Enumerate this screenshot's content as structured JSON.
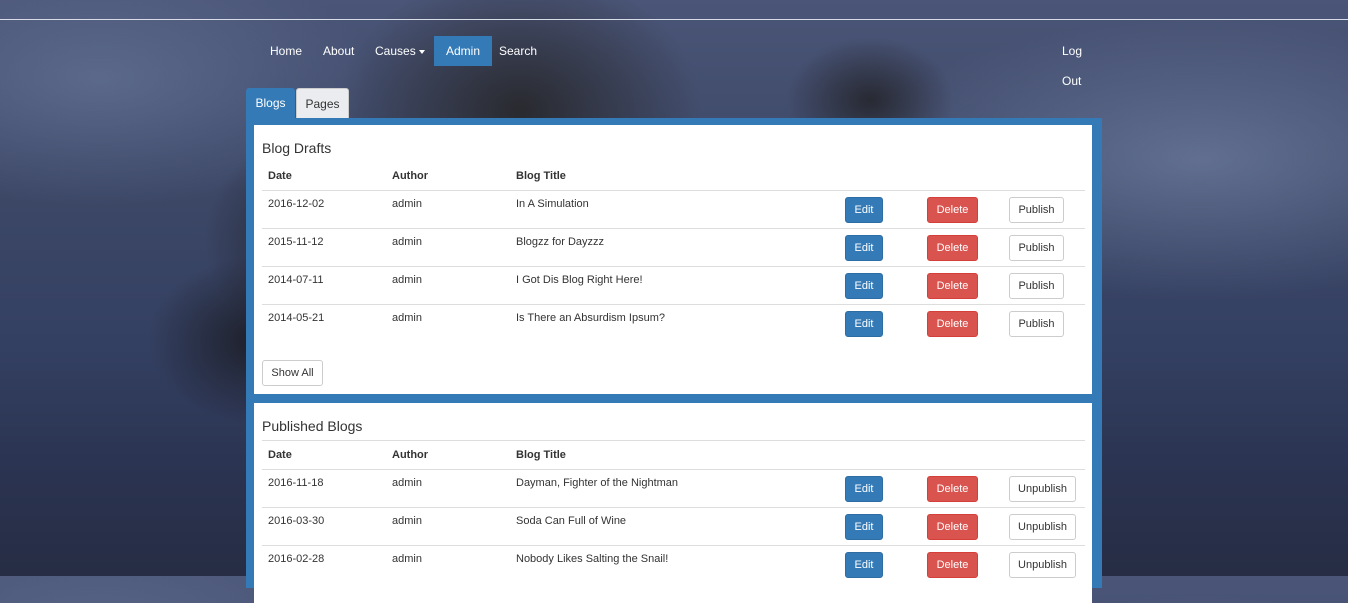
{
  "nav": {
    "items": [
      {
        "label": "Home"
      },
      {
        "label": "About"
      },
      {
        "label": "Causes"
      },
      {
        "label": "Admin"
      },
      {
        "label": "Search"
      }
    ],
    "logout": "Log Out"
  },
  "tabs": [
    {
      "label": "Blogs"
    },
    {
      "label": "Pages"
    }
  ],
  "drafts": {
    "title": "Blog Drafts",
    "columns": [
      "Date",
      "Author",
      "Blog Title"
    ],
    "rows": [
      {
        "date": "2016-12-02",
        "author": "admin",
        "title": "In A Simulation"
      },
      {
        "date": "2015-11-12",
        "author": "admin",
        "title": "Blogzz for Dayzzz"
      },
      {
        "date": "2014-07-11",
        "author": "admin",
        "title": "I Got Dis Blog Right Here!"
      },
      {
        "date": "2014-05-21",
        "author": "admin",
        "title": "Is There an Absurdism Ipsum?"
      }
    ],
    "edit_label": "Edit",
    "delete_label": "Delete",
    "publish_label": "Publish",
    "show_all_label": "Show All"
  },
  "published": {
    "title": "Published Blogs",
    "columns": [
      "Date",
      "Author",
      "Blog Title"
    ],
    "rows": [
      {
        "date": "2016-11-18",
        "author": "admin",
        "title": "Dayman, Fighter of the Nightman"
      },
      {
        "date": "2016-03-30",
        "author": "admin",
        "title": "Soda Can Full of Wine"
      },
      {
        "date": "2016-02-28",
        "author": "admin",
        "title": "Nobody Likes Salting the Snail!"
      }
    ],
    "edit_label": "Edit",
    "delete_label": "Delete",
    "unpublish_label": "Unpublish"
  },
  "colors": {
    "primary": "#337ab7",
    "danger": "#d9534f"
  }
}
